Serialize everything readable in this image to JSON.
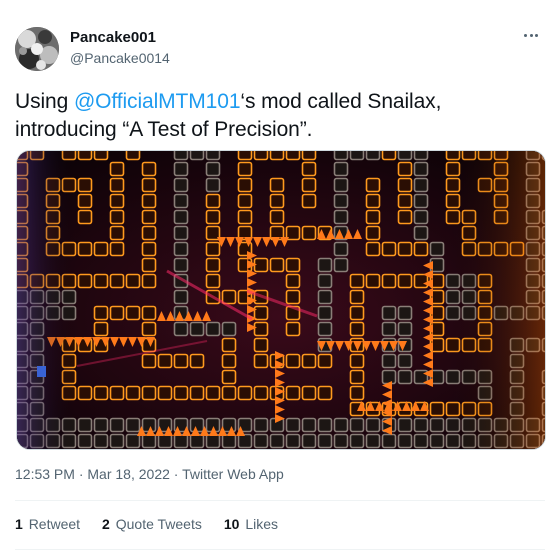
{
  "author": {
    "display_name": "Pancake001",
    "handle": "@Pancake0014",
    "avatar_icon": "avatar-photo"
  },
  "more_icon": "more-options-icon",
  "tweet": {
    "text_before": "Using ",
    "mention": "@OfficialMTM101",
    "text_after": "‘s mod called Snailax, introducing “A Test of Precision”."
  },
  "media": {
    "description": "game-screenshot",
    "colors": {
      "background": "#12040a",
      "block_orange": "#ff9a1e",
      "block_grey": "#8a7f78",
      "spike_orange": "#ff7a1a",
      "laser_pink": "#ff2a6a",
      "player_blue": "#3a7aff"
    }
  },
  "meta": {
    "time": "12:53 PM",
    "separator1": " · ",
    "date": "Mar 18, 2022",
    "separator2": " · ",
    "source": "Twitter Web App"
  },
  "stats": {
    "retweets_count": "1",
    "retweets_label": "Retweet",
    "quotes_count": "2",
    "quotes_label": "Quote Tweets",
    "likes_count": "10",
    "likes_label": "Likes"
  }
}
